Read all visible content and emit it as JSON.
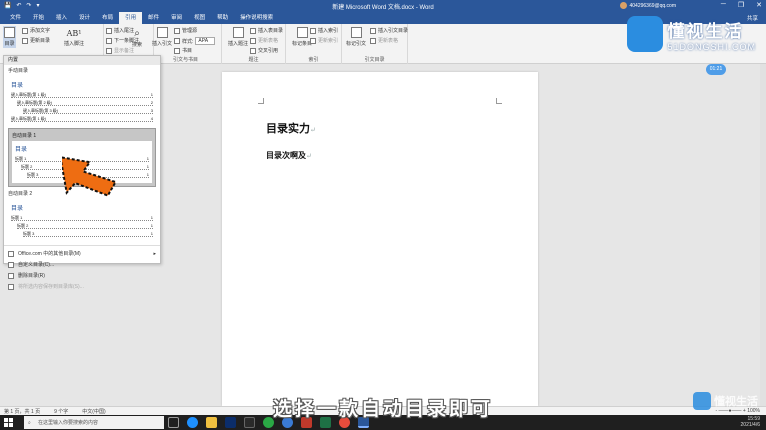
{
  "window": {
    "qat": [
      "💾",
      "↶",
      "↷",
      "▾"
    ],
    "title": "新建 Microsoft Word 文档.docx - Word",
    "user": "404296369@qq.com",
    "controls": [
      "─",
      "❐",
      "✕"
    ]
  },
  "tabs": [
    "文件",
    "开始",
    "插入",
    "设计",
    "布局",
    "引用",
    "邮件",
    "审阅",
    "视图",
    "帮助",
    "操作说明搜索"
  ],
  "active_tab": "引用",
  "share": "共享",
  "ribbon": {
    "toc_button": "目录",
    "add_text": "添加文字",
    "update_table": "更新目录",
    "insert_footnote": "插入脚注",
    "insert_endnote": "插入尾注",
    "next_footnote": "下一条脚注",
    "show_notes": "显示备注",
    "search": "搜索",
    "insert_citation": "插入引文",
    "manage_sources": "管理源",
    "style_label": "样式:",
    "style_value": "APA",
    "bibliography": "书目",
    "insert_caption": "插入题注",
    "insert_table_of_figures": "插入表目录",
    "update_table_figures": "更新表格",
    "cross_reference": "交叉引用",
    "mark_entry": "标记条目",
    "insert_index": "插入索引",
    "update_index": "更新索引",
    "mark_citation": "标记引文",
    "insert_table_of_authorities": "插入引文目录",
    "update_table_authorities": "更新表格",
    "groups": {
      "citations": "引文与书目",
      "captions": "题注",
      "index": "索引",
      "authorities": "引文目录"
    }
  },
  "dropdown": {
    "header": "内置",
    "manual_label": "手动目录",
    "manual_title": "目录",
    "manual_lines": [
      "键入章标题(第 1 级)",
      "键入章标题(第 2 级)",
      "键入章标题(第 3 级)",
      "键入章标题(第 1 级)"
    ],
    "manual_pages": [
      "1",
      "2",
      "3",
      "4"
    ],
    "auto1_label": "自动目录 1",
    "auto1_title": "目录",
    "auto1_lines": [
      "标题 1",
      "标题 2",
      "标题 3"
    ],
    "auto2_label": "自动目录 2",
    "auto2_title": "目录",
    "auto2_lines": [
      "标题 1",
      "标题 2",
      "标题 3"
    ],
    "page_num": "1",
    "menu": {
      "more": "Office.com 中的其他目录(M)",
      "custom": "自定义目录(C)...",
      "remove": "删除目录(R)",
      "save": "将所选内容保存到目录库(S)..."
    }
  },
  "document": {
    "heading": "目录实力",
    "subheading": "目录次啊及",
    "para_mark": "↵"
  },
  "status": {
    "page": "第 1 页，共 1 页",
    "words": "9 个字",
    "lang": "中文(中国)",
    "zoom": "- ——●—— + 100%"
  },
  "taskbar": {
    "search_placeholder": "在这里输入你要搜索的内容",
    "time": "15:59",
    "date": "2021/4/6",
    "tray_label": "周二"
  },
  "overlay": {
    "subtitle": "选择一款自动目录即可",
    "brand_cn": "懂视生活",
    "brand_en": "51DONGSHI.COM",
    "time_badge": "01:21"
  },
  "colors": {
    "word_blue": "#2b579a",
    "arrow_orange": "#ee6d12"
  }
}
